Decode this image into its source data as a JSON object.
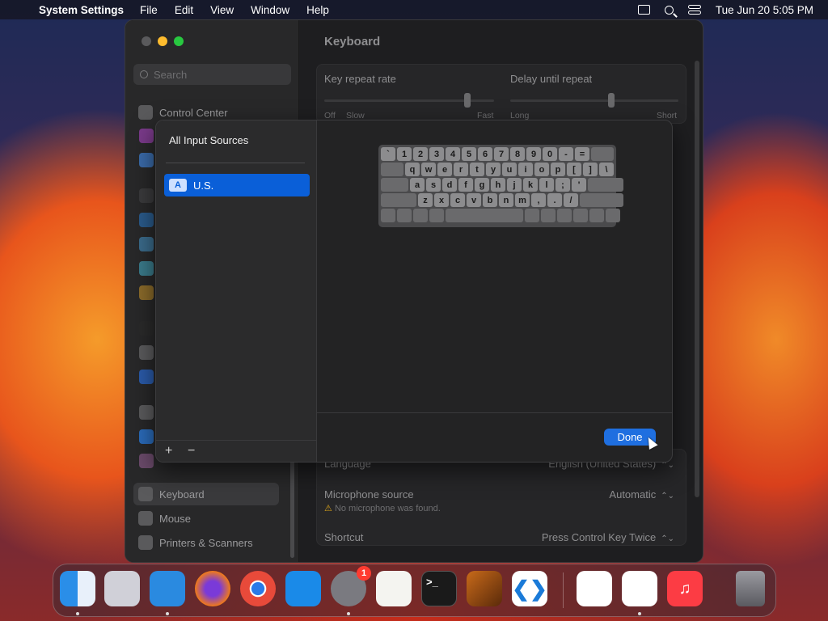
{
  "menubar": {
    "apple": "",
    "app_name": "System Settings",
    "menus": [
      "File",
      "Edit",
      "View",
      "Window",
      "Help"
    ],
    "datetime": "Tue Jun 20  5:05 PM"
  },
  "settings": {
    "search_placeholder": "Search",
    "sidebar": {
      "control_center": "Control Center",
      "keyboard": "Keyboard",
      "mouse": "Mouse",
      "printers": "Printers & Scanners"
    },
    "title": "Keyboard",
    "key_repeat": {
      "label": "Key repeat rate",
      "left": "Off",
      "mid": "Slow",
      "right": "Fast"
    },
    "delay_repeat": {
      "label": "Delay until repeat",
      "left": "Long",
      "right": "Short"
    },
    "language": {
      "label": "Language",
      "value": "English (United States)"
    },
    "microphone": {
      "label": "Microphone source",
      "value": "Automatic",
      "warning": "No microphone was found."
    },
    "shortcut": {
      "label": "Shortcut",
      "value": "Press Control Key Twice"
    }
  },
  "sheet": {
    "header": "All Input Sources",
    "selected_source": {
      "badge": "A",
      "name": "U.S."
    },
    "add": "+",
    "remove": "−",
    "done": "Done",
    "keyboard_rows": [
      [
        "`",
        "1",
        "2",
        "3",
        "4",
        "5",
        "6",
        "7",
        "8",
        "9",
        "0",
        "-",
        "="
      ],
      [
        "q",
        "w",
        "e",
        "r",
        "t",
        "y",
        "u",
        "i",
        "o",
        "p",
        "[",
        "]",
        "\\"
      ],
      [
        "a",
        "s",
        "d",
        "f",
        "g",
        "h",
        "j",
        "k",
        "l",
        ";",
        "'"
      ],
      [
        "z",
        "x",
        "c",
        "v",
        "b",
        "n",
        "m",
        ",",
        ".",
        "/"
      ]
    ]
  },
  "dock": {
    "settings_badge": "1",
    "terminal_prompt": ">_"
  }
}
